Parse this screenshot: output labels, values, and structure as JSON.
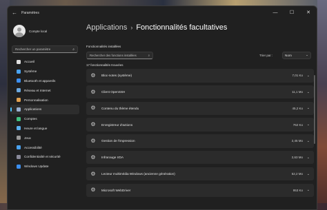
{
  "window": {
    "title": "Paramètres",
    "back_glyph": "←",
    "controls": {
      "minimize": "—",
      "maximize": "☐",
      "close": "✕"
    }
  },
  "profile": {
    "name": "Compte local"
  },
  "sidebar": {
    "search_placeholder": "Rechercher un paramètre",
    "items": [
      {
        "label": "Accueil",
        "icon": "home-icon",
        "color": "#e0e0e0"
      },
      {
        "label": "Système",
        "icon": "monitor-icon",
        "color": "#4aa3f0"
      },
      {
        "label": "Bluetooth et appareils",
        "icon": "bluetooth-icon",
        "color": "#3c8ff0"
      },
      {
        "label": "Réseau et Internet",
        "icon": "network-icon",
        "color": "#6aa8e0"
      },
      {
        "label": "Personnalisation",
        "icon": "brush-icon",
        "color": "#e0a050"
      },
      {
        "label": "Applications",
        "icon": "apps-icon",
        "color": "#9ab0d0",
        "active": true
      },
      {
        "label": "Comptes",
        "icon": "accounts-icon",
        "color": "#40c080"
      },
      {
        "label": "Heure et langue",
        "icon": "clock-icon",
        "color": "#5ab0f0"
      },
      {
        "label": "Jeux",
        "icon": "gamepad-icon",
        "color": "#9a9a9a"
      },
      {
        "label": "Accessibilité",
        "icon": "accessibility-icon",
        "color": "#4aa3f0"
      },
      {
        "label": "Confidentialité et sécurité",
        "icon": "shield-icon",
        "color": "#8a8a9a"
      },
      {
        "label": "Windows Update",
        "icon": "update-icon",
        "color": "#3c8ff0"
      }
    ]
  },
  "breadcrumb": {
    "parent": "Applications",
    "separator": "›",
    "current": "Fonctionnalités facultatives"
  },
  "installed": {
    "section_title": "Fonctionnalités installées",
    "search_placeholder": "Rechercher des fonctions installées",
    "sort_label": "Trier par :",
    "sort_value": "Nom",
    "count_text": "17 fonctionnalités trouvées",
    "features": [
      {
        "name": "Bloc-notes (système)",
        "size": "7,01 Ko"
      },
      {
        "name": "Client OpenSSH",
        "size": "11,1 Mo"
      },
      {
        "name": "Contenu du thème étendu",
        "size": "45,2 Ko"
      },
      {
        "name": "Enregistreur d'actions",
        "size": "762 Ko"
      },
      {
        "name": "Gestion de l'impression",
        "size": "2,45 Mo"
      },
      {
        "name": "Infrarouge IrDA",
        "size": "2,63 Mo"
      },
      {
        "name": "Lecteur multimédia Windows (ancienne génération)",
        "size": "52,2 Mo"
      },
      {
        "name": "Microsoft WebDriver",
        "size": "953 Ko"
      }
    ]
  }
}
